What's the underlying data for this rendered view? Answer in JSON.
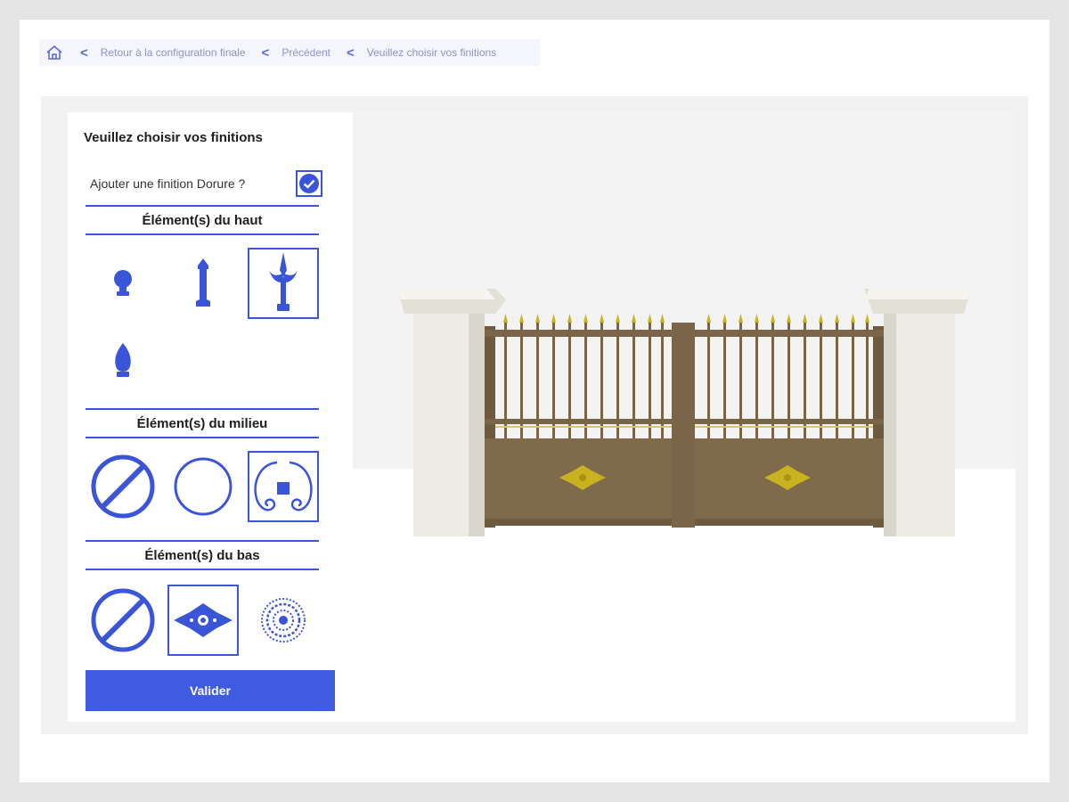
{
  "breadcrumb": {
    "items": [
      {
        "label": "Retour à la configuration finale"
      },
      {
        "label": "Précédent"
      },
      {
        "label": "Veuillez choisir vos finitions"
      }
    ]
  },
  "panel": {
    "title": "Veuillez choisir vos finitions",
    "gilding_label": "Ajouter une finition Dorure ?",
    "gilding_checked": true,
    "sections": {
      "top": {
        "title": "Élément(s) du haut"
      },
      "middle": {
        "title": "Élément(s) du milieu"
      },
      "bottom": {
        "title": "Élément(s) du bas"
      }
    },
    "validate_label": "Valider"
  },
  "colors": {
    "accent": "#3b55d9",
    "button": "#3f5be0",
    "gate": "#7a6548",
    "gold": "#c9b21f",
    "pillar": "#eeece4"
  }
}
